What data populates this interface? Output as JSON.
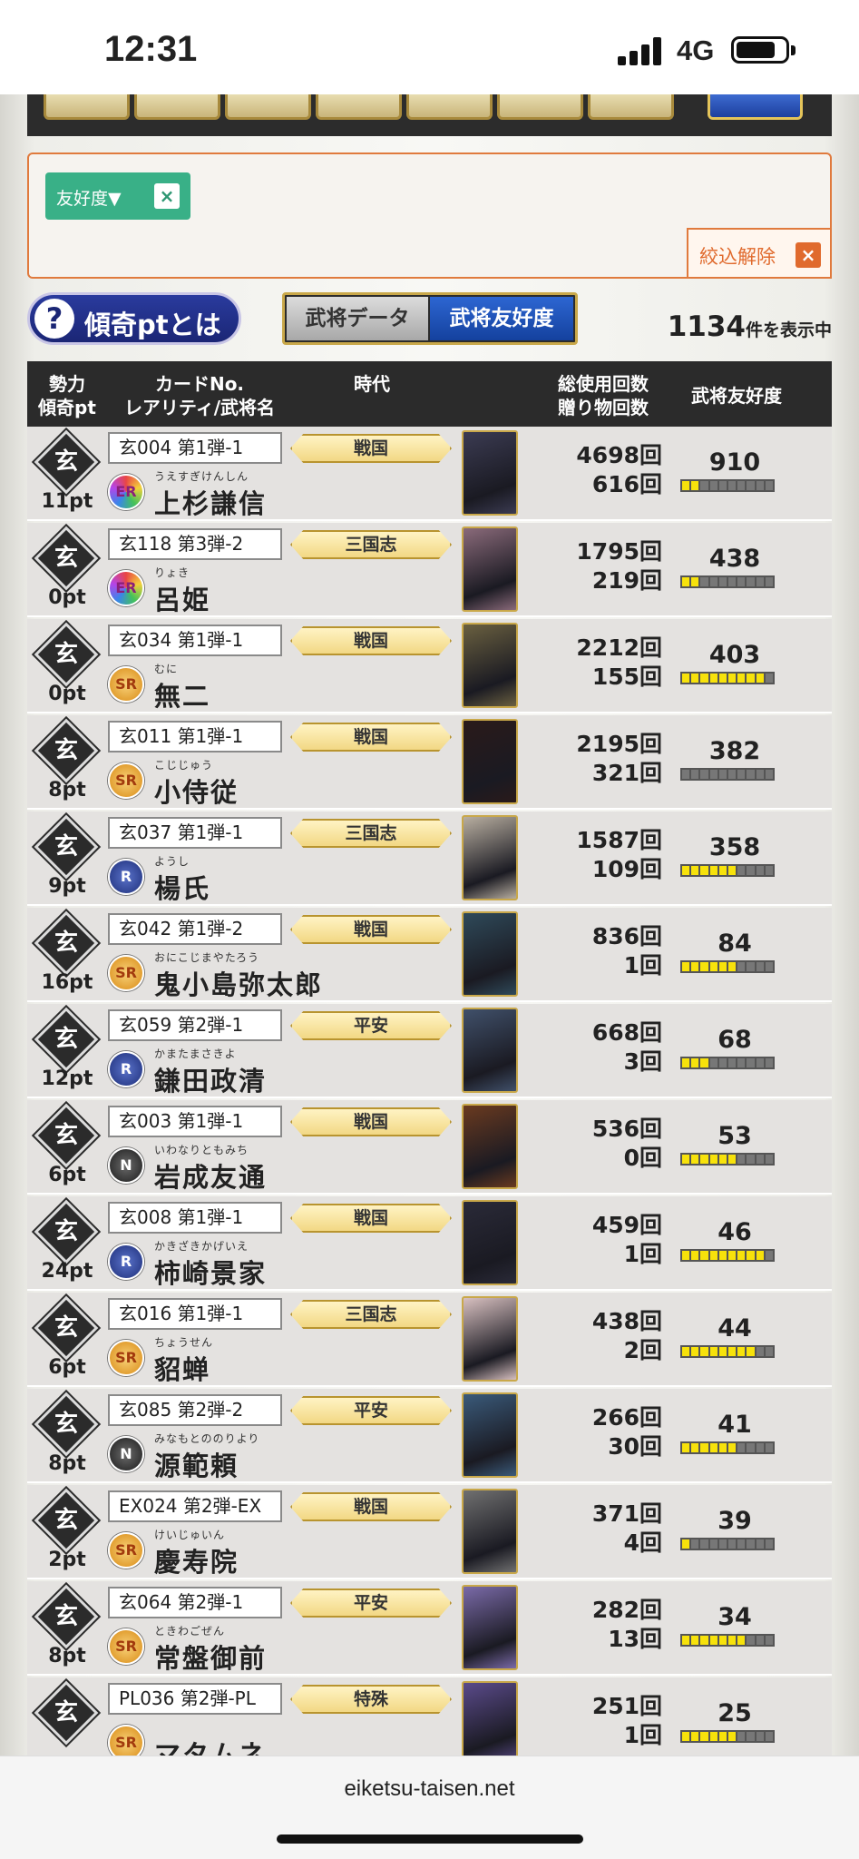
{
  "status": {
    "time": "12:31",
    "network": "4G"
  },
  "filter": {
    "chip_label": "友好度▼",
    "chip_close": "×",
    "clear_label": "絞込解除",
    "clear_close": "×"
  },
  "info_button": {
    "q": "?",
    "label": "傾奇ptとは"
  },
  "view_toggle": {
    "left": "武将データ",
    "right": "武将友好度"
  },
  "result": {
    "count": "1134",
    "suffix": "件を表示中"
  },
  "header": {
    "col1_line1": "勢力",
    "col1_line2": "傾奇pt",
    "col2_line1": "カードNo.",
    "col2_line2": "レアリティ/武将名",
    "col3": "時代",
    "col4_line1": "総使用回数",
    "col4_line2": "贈り物回数",
    "col5": "武将友好度"
  },
  "rows": [
    {
      "faction": "玄",
      "pt": "11pt",
      "card_no": "玄004 第1弾-1",
      "rarity": "ER",
      "ruby": "うえすぎけんしん",
      "name": "上杉謙信",
      "era": "戦国",
      "uses": "4698回",
      "gifts": "616回",
      "friendship": "910",
      "level": 2,
      "color": "#3b3b52"
    },
    {
      "faction": "玄",
      "pt": "0pt",
      "card_no": "玄118 第3弾-2",
      "rarity": "ER",
      "ruby": "りょき",
      "name": "呂姫",
      "era": "三国志",
      "uses": "1795回",
      "gifts": "219回",
      "friendship": "438",
      "level": 2,
      "color": "#8a6a7a"
    },
    {
      "faction": "玄",
      "pt": "0pt",
      "card_no": "玄034 第1弾-1",
      "rarity": "SR",
      "ruby": "むに",
      "name": "無二",
      "era": "戦国",
      "uses": "2212回",
      "gifts": "155回",
      "friendship": "403",
      "level": 9,
      "color": "#6a6040"
    },
    {
      "faction": "玄",
      "pt": "8pt",
      "card_no": "玄011 第1弾-1",
      "rarity": "SR",
      "ruby": "こじじゅう",
      "name": "小侍従",
      "era": "戦国",
      "uses": "2195回",
      "gifts": "321回",
      "friendship": "382",
      "level": 0,
      "color": "#2a1a1a"
    },
    {
      "faction": "玄",
      "pt": "9pt",
      "card_no": "玄037 第1弾-1",
      "rarity": "R",
      "ruby": "ようし",
      "name": "楊氏",
      "era": "三国志",
      "uses": "1587回",
      "gifts": "109回",
      "friendship": "358",
      "level": 6,
      "color": "#b8aea0"
    },
    {
      "faction": "玄",
      "pt": "16pt",
      "card_no": "玄042 第1弾-2",
      "rarity": "SR",
      "ruby": "おにこじまやたろう",
      "name": "鬼小島弥太郎",
      "era": "戦国",
      "uses": "836回",
      "gifts": "1回",
      "friendship": "84",
      "level": 6,
      "color": "#2f4a5a"
    },
    {
      "faction": "玄",
      "pt": "12pt",
      "card_no": "玄059 第2弾-1",
      "rarity": "R",
      "ruby": "かまたまさきよ",
      "name": "鎌田政清",
      "era": "平安",
      "uses": "668回",
      "gifts": "3回",
      "friendship": "68",
      "level": 3,
      "color": "#40506a"
    },
    {
      "faction": "玄",
      "pt": "6pt",
      "card_no": "玄003 第1弾-1",
      "rarity": "N",
      "ruby": "いわなりともみち",
      "name": "岩成友通",
      "era": "戦国",
      "uses": "536回",
      "gifts": "0回",
      "friendship": "53",
      "level": 6,
      "color": "#6a3a20"
    },
    {
      "faction": "玄",
      "pt": "24pt",
      "card_no": "玄008 第1弾-1",
      "rarity": "R",
      "ruby": "かきざきかげいえ",
      "name": "柿崎景家",
      "era": "戦国",
      "uses": "459回",
      "gifts": "1回",
      "friendship": "46",
      "level": 9,
      "color": "#2a2a38"
    },
    {
      "faction": "玄",
      "pt": "6pt",
      "card_no": "玄016 第1弾-1",
      "rarity": "SR",
      "ruby": "ちょうせん",
      "name": "貂蝉",
      "era": "三国志",
      "uses": "438回",
      "gifts": "2回",
      "friendship": "44",
      "level": 8,
      "color": "#d8c0c0"
    },
    {
      "faction": "玄",
      "pt": "8pt",
      "card_no": "玄085 第2弾-2",
      "rarity": "N",
      "ruby": "みなもとののりより",
      "name": "源範頼",
      "era": "平安",
      "uses": "266回",
      "gifts": "30回",
      "friendship": "41",
      "level": 6,
      "color": "#3a5a7a"
    },
    {
      "faction": "玄",
      "pt": "2pt",
      "card_no": "EX024 第2弾-EX",
      "rarity": "SR",
      "ruby": "けいじゅいん",
      "name": "慶寿院",
      "era": "戦国",
      "uses": "371回",
      "gifts": "4回",
      "friendship": "39",
      "level": 1,
      "color": "#707070"
    },
    {
      "faction": "玄",
      "pt": "8pt",
      "card_no": "玄064 第2弾-1",
      "rarity": "SR",
      "ruby": "ときわごぜん",
      "name": "常盤御前",
      "era": "平安",
      "uses": "282回",
      "gifts": "13回",
      "friendship": "34",
      "level": 7,
      "color": "#7a6aa8"
    },
    {
      "faction": "玄",
      "pt": "",
      "card_no": "PL036 第2弾-PL",
      "rarity": "SR",
      "ruby": "",
      "name": "マタムネ",
      "era": "特殊",
      "uses": "251回",
      "gifts": "1回",
      "friendship": "25",
      "level": 6,
      "color": "#5a4a8a"
    }
  ],
  "browser": {
    "url": "eiketsu-taisen.net"
  }
}
